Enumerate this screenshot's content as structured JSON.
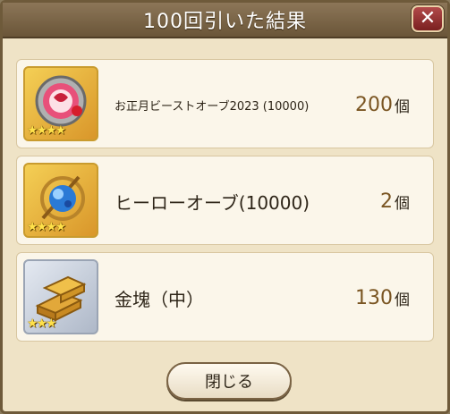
{
  "dialog": {
    "title": "100回引いた結果",
    "close_icon": "close-x-icon"
  },
  "items": [
    {
      "name": "お正月ビーストオーブ2023 (10000)",
      "quantity": "200",
      "unit": "個",
      "stars": "★★★★",
      "icon": "beast-orb-icon",
      "rarity": 4
    },
    {
      "name": "ヒーローオーブ(10000)",
      "quantity": "2",
      "unit": "個",
      "stars": "★★★★",
      "icon": "hero-orb-icon",
      "rarity": 4
    },
    {
      "name": "金塊（中）",
      "quantity": "130",
      "unit": "個",
      "stars": "★★★",
      "icon": "gold-ingot-icon",
      "rarity": 3
    }
  ],
  "footer": {
    "close_label": "閉じる"
  },
  "colors": {
    "titlebar": "#7a6548",
    "panel": "#efe3c6",
    "quantity": "#7a5522",
    "star": "#ffe14a"
  }
}
